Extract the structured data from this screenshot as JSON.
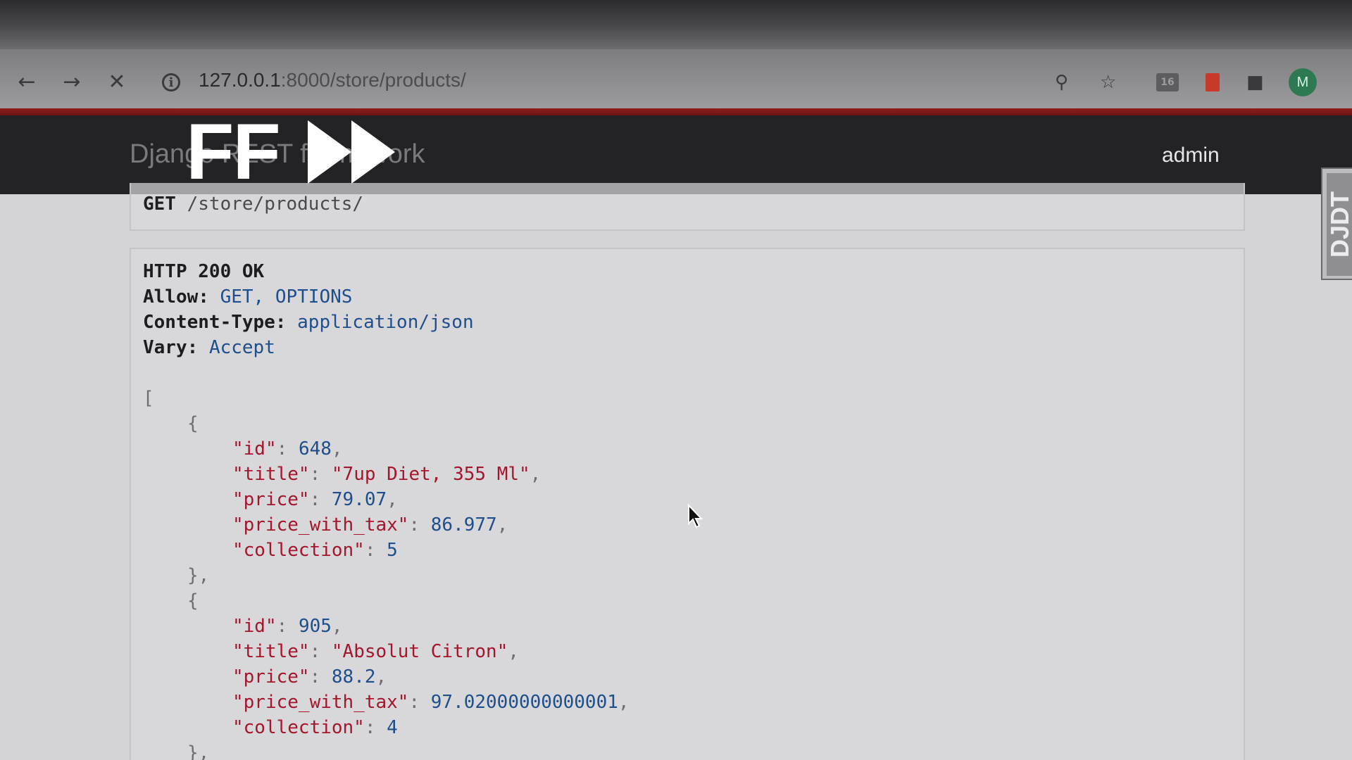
{
  "browser": {
    "url_host": "127.0.0.1",
    "url_rest": ":8000/store/products/",
    "profile_initial": "M",
    "extension_label": "16"
  },
  "navbar": {
    "brand": "Django REST framework",
    "user": "admin",
    "overlay_text": "FF"
  },
  "side_tab": {
    "label": "DJDT"
  },
  "request": {
    "method": "GET",
    "path": "/store/products/"
  },
  "response": {
    "status": "HTTP 200 OK",
    "headers": [
      {
        "key": "Allow:",
        "value": "GET, OPTIONS"
      },
      {
        "key": "Content-Type:",
        "value": "application/json"
      },
      {
        "key": "Vary:",
        "value": "Accept"
      }
    ],
    "open_bracket": "[",
    "items": [
      {
        "id": "648",
        "title": "\"7up Diet, 355 Ml\"",
        "price": "79.07",
        "price_with_tax": "86.977",
        "collection": "5"
      },
      {
        "id": "905",
        "title": "\"Absolut Citron\"",
        "price": "88.2",
        "price_with_tax": "97.02000000000001",
        "collection": "4"
      }
    ],
    "keys": {
      "id": "\"id\"",
      "title": "\"title\"",
      "price": "\"price\"",
      "price_with_tax": "\"price_with_tax\"",
      "collection": "\"collection\""
    }
  }
}
